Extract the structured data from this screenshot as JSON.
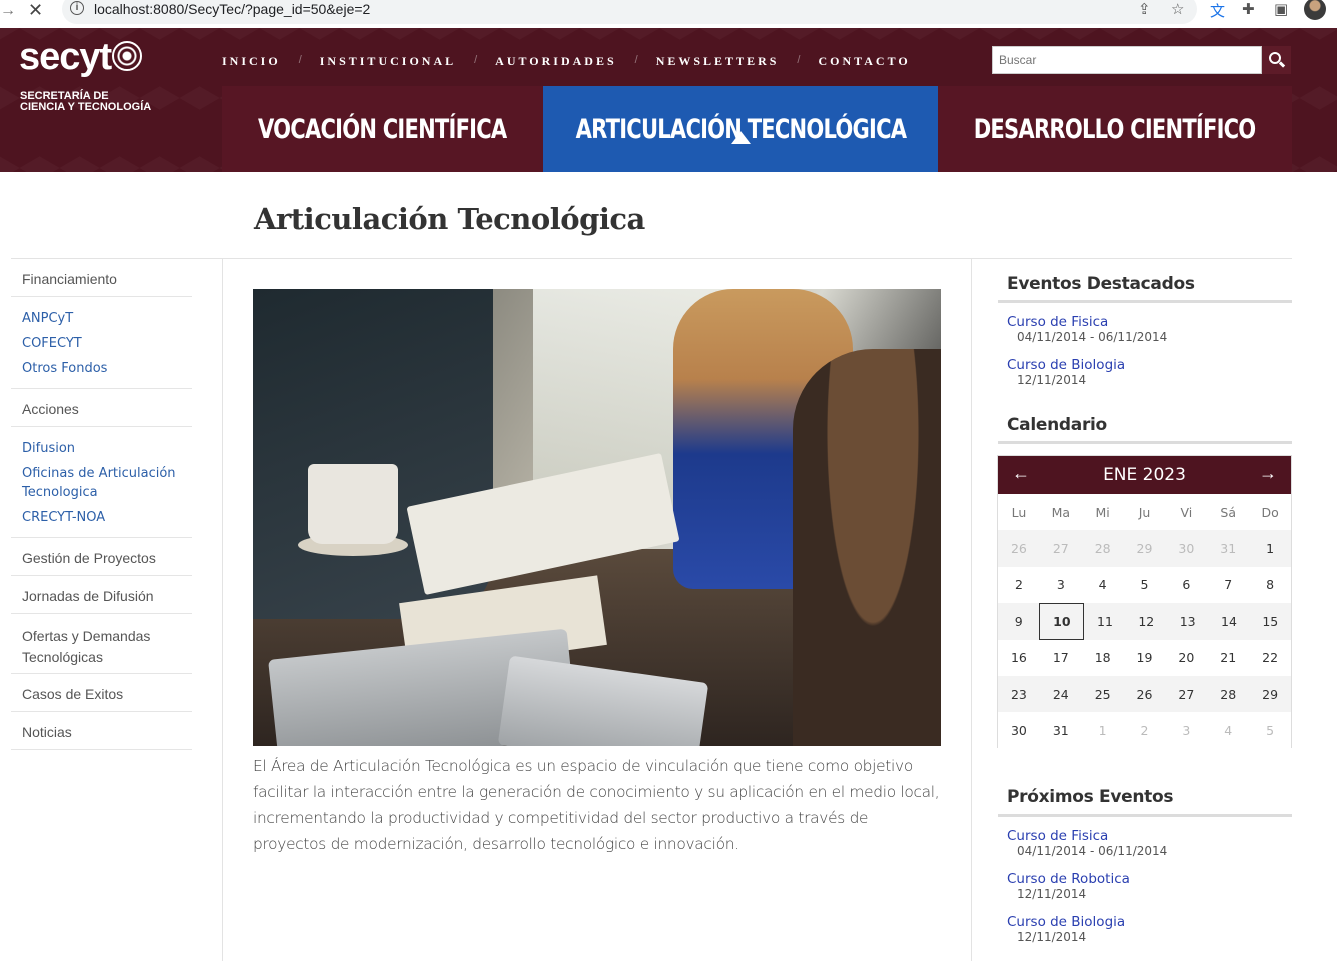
{
  "browser": {
    "url": "localhost:8080/SecyTec/?page_id=50&eje=2"
  },
  "header": {
    "logo": "secyt",
    "logo_sub_line1": "SECRETARÍA DE",
    "logo_sub_line2": "CIENCIA Y TECNOLOGÍA",
    "nav": [
      "INICIO",
      "INSTITUCIONAL",
      "AUTORIDADES",
      "NEWSLETTERS",
      "CONTACTO"
    ],
    "nav_separator": "/",
    "search_placeholder": "Buscar",
    "axes": [
      "VOCACIÓN CIENTÍFICA",
      "ARTICULACIÓN TECNOLÓGICA",
      "DESARROLLO CIENTÍFICO"
    ],
    "active_axis": "ARTICULACIÓN TECNOLÓGICA"
  },
  "colors": {
    "header_bg": "#4e1420",
    "active_tab": "#1e5ab1",
    "link": "#2c5fa8"
  },
  "page": {
    "title": "Articulación Tecnológica",
    "body": "El Área de Articulación Tecnológica es un espacio de vinculación que tiene como objetivo facilitar la interacción entre la generación de conocimiento y su aplicación en el medio local, incrementando la productividad y competitividad del sector productivo a través de proyectos de modernización, desarrollo tecnológico e innovación."
  },
  "sidebar": {
    "financiamiento": "Financiamiento",
    "financiamiento_links": [
      "ANPCyT",
      "COFECYT",
      "Otros Fondos"
    ],
    "acciones": "Acciones",
    "acciones_links": [
      "Difusion",
      "Oficinas de Articulación Tecnologica",
      "CRECYT-NOA"
    ],
    "gestion": "Gestión de Proyectos",
    "jornadas": "Jornadas de Difusión",
    "ofertas": "Ofertas y Demandas Tecnológicas",
    "casos": "Casos de Exitos",
    "noticias": "Noticias"
  },
  "destacados": {
    "title": "Eventos Destacados",
    "events": [
      {
        "name": "Curso de Fisica",
        "date": "04/11/2014 - 06/11/2014"
      },
      {
        "name": "Curso de Biologia",
        "date": "12/11/2014"
      }
    ]
  },
  "calendario": {
    "title": "Calendario",
    "month": "ENE 2023",
    "days": [
      "Lu",
      "Ma",
      "Mi",
      "Ju",
      "Vi",
      "Sá",
      "Do"
    ],
    "weeks": [
      [
        "26",
        "27",
        "28",
        "29",
        "30",
        "31",
        "1"
      ],
      [
        "2",
        "3",
        "4",
        "5",
        "6",
        "7",
        "8"
      ],
      [
        "9",
        "10",
        "11",
        "12",
        "13",
        "14",
        "15"
      ],
      [
        "16",
        "17",
        "18",
        "19",
        "20",
        "21",
        "22"
      ],
      [
        "23",
        "24",
        "25",
        "26",
        "27",
        "28",
        "29"
      ],
      [
        "30",
        "31",
        "1",
        "2",
        "3",
        "4",
        "5"
      ]
    ],
    "today": "10"
  },
  "proximos": {
    "title": "Próximos Eventos",
    "events": [
      {
        "name": "Curso de Fisica",
        "date": "04/11/2014 - 06/11/2014"
      },
      {
        "name": "Curso de Robotica",
        "date": "12/11/2014"
      },
      {
        "name": "Curso de Biologia",
        "date": "12/11/2014"
      }
    ]
  }
}
